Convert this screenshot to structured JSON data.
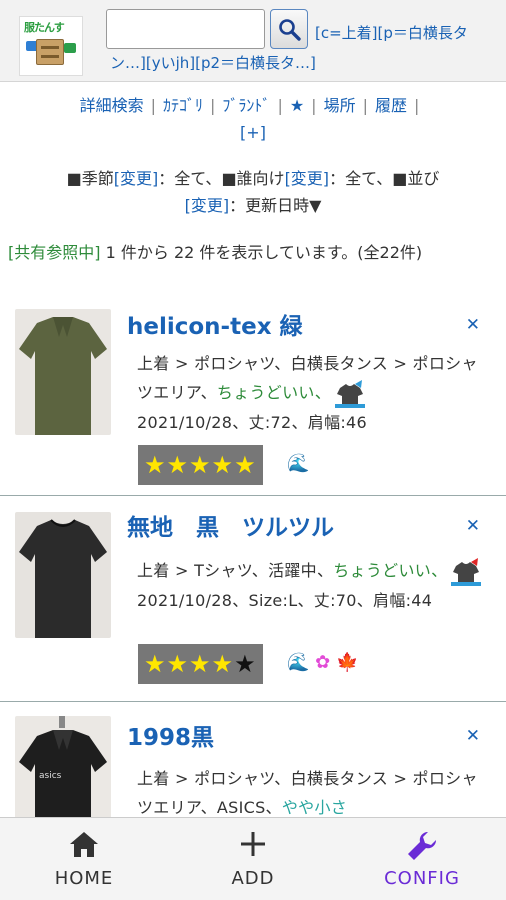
{
  "header": {
    "logo_text": "服たんす",
    "search_value": "",
    "filter_text": "[c=上着][p＝白横長タン…][yいjh][p2＝白横長タ…]"
  },
  "nav": {
    "items": [
      "詳細検索",
      "ｶﾃｺﾞﾘ",
      "ﾌﾞﾗﾝﾄﾞ",
      "★",
      "場所",
      "履歴",
      "[+]"
    ]
  },
  "sort": {
    "season_label": "■季節",
    "season_change": "[変更]",
    "season_value": "：全て、",
    "target_label": "■誰向け",
    "target_change": "[変更]",
    "target_value": "：全て、",
    "order_label": "■並び",
    "order_change": "[変更]",
    "order_value": "：更新日時▼"
  },
  "count": {
    "shared": "[共有参照中]",
    "text": " 1 件から 22 件を表示しています。(全22件)"
  },
  "items": [
    {
      "title": "helicon-tex 緑",
      "category": "上着 > ポロシャツ、白横長タンス > ポロシャツエリア、",
      "tag": "ちょうどいい、",
      "details": "2021/10/28、丈:72、肩幅:46",
      "rating_on": "★★★★★",
      "rating_off": "",
      "icons": "🌊",
      "color": "#5c6440"
    },
    {
      "title": "無地　黒　ツルツル",
      "category": "上着 > Tシャツ、活躍中、",
      "tag": "ちょうどいい、",
      "details": "2021/10/28、Size:L、丈:70、肩幅:44",
      "rating_on": "★★★★",
      "rating_off": "★",
      "icons": "🌊 ✿ 🍁",
      "color": "#2b2b2b"
    },
    {
      "title": "1998黒",
      "category": "上着 > ポロシャツ、白横長タンス > ポロシャツエリア、ASICS、",
      "tag": "やや小さ",
      "details": "",
      "rating_on": "",
      "rating_off": "",
      "icons": "",
      "color": "#1e1e1e"
    }
  ],
  "tabs": {
    "home": "HOME",
    "add": "ADD",
    "config": "CONFIG"
  },
  "colors": {
    "link": "#1a62b4",
    "tag_green": "#2e8b3a",
    "active_tab": "#6a2bd6",
    "star": "#ffe600"
  }
}
